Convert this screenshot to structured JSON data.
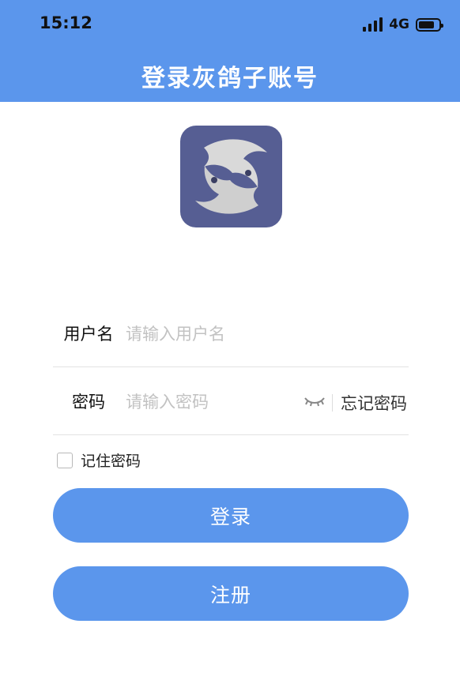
{
  "status_bar": {
    "time": "15:12",
    "network": "4G",
    "icons": [
      "signal-icon",
      "battery-icon"
    ]
  },
  "header": {
    "title": "登录灰鸽子账号",
    "background_color": "#5b96ec"
  },
  "logo": {
    "icon": "pigeon-logo-icon",
    "background_color": "#565e93"
  },
  "form": {
    "username": {
      "label": "用户名",
      "placeholder": "请输入用户名",
      "value": ""
    },
    "password": {
      "label": "密码",
      "placeholder": "请输入密码",
      "value": "",
      "toggle_icon": "eye-closed-icon",
      "forgot_label": "忘记密码"
    },
    "remember": {
      "label": "记住密码",
      "checked": false
    }
  },
  "buttons": {
    "login_label": "登录",
    "register_label": "注册",
    "color": "#5b96ec"
  }
}
